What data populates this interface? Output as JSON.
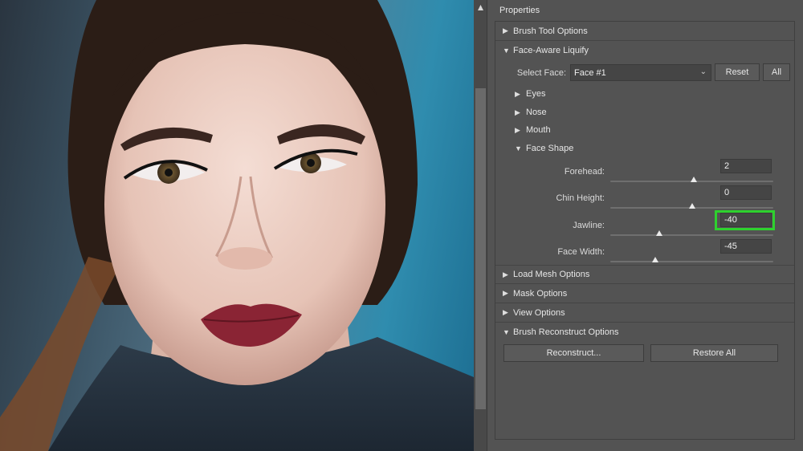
{
  "panel": {
    "title": "Properties",
    "sections": {
      "brush_tool_options": "Brush Tool Options",
      "face_aware_liquify": "Face-Aware Liquify",
      "load_mesh_options": "Load Mesh Options",
      "mask_options": "Mask Options",
      "view_options": "View Options",
      "brush_reconstruct_options": "Brush Reconstruct Options"
    },
    "select_face": {
      "label": "Select Face:",
      "value": "Face #1",
      "reset_label": "Reset",
      "all_label": "All"
    },
    "subgroups": {
      "eyes": "Eyes",
      "nose": "Nose",
      "mouth": "Mouth",
      "face_shape": "Face Shape"
    },
    "face_shape_fields": [
      {
        "label": "Forehead:",
        "value": "2",
        "slider_fraction": 0.51
      },
      {
        "label": "Chin Height:",
        "value": "0",
        "slider_fraction": 0.5
      },
      {
        "label": "Jawline:",
        "value": "-40",
        "slider_fraction": 0.3
      },
      {
        "label": "Face Width:",
        "value": "-45",
        "slider_fraction": 0.275
      }
    ],
    "buttons": {
      "reconstruct": "Reconstruct...",
      "restore_all": "Restore All"
    }
  },
  "colors": {
    "panel_bg": "#535353",
    "highlight": "#2ed12e"
  },
  "icons": {
    "expanded": "triangle-down-icon",
    "collapsed": "triangle-right-icon",
    "scroll_up": "scroll-up-arrow-icon",
    "dropdown": "chevron-down-icon"
  }
}
